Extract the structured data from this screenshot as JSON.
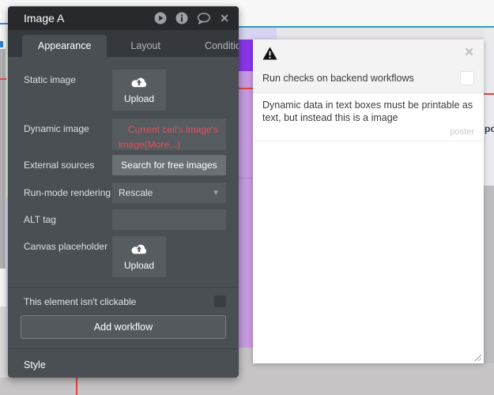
{
  "inspector": {
    "title": "Image A",
    "tabs": {
      "appearance": "Appearance",
      "layout": "Layout",
      "conditional": "Conditional"
    },
    "fields": {
      "static_image": {
        "label": "Static image",
        "button": "Upload"
      },
      "dynamic_image": {
        "label": "Dynamic image",
        "value": "Current cell's image's image(More...)"
      },
      "external_sources": {
        "label": "External sources",
        "button": "Search for free images"
      },
      "run_mode": {
        "label": "Run-mode rendering",
        "value": "Rescale"
      },
      "alt_tag": {
        "label": "ALT tag",
        "value": ""
      },
      "canvas_placeholder": {
        "label": "Canvas placeholder",
        "button": "Upload"
      }
    },
    "clickable": {
      "label": "This element isn't clickable",
      "checked": false
    },
    "add_workflow": "Add workflow",
    "style_section": "Style",
    "titlebar_icons": [
      "play-icon",
      "info-icon",
      "comment-icon",
      "close-icon"
    ]
  },
  "issues": {
    "run_checks_label": "Run checks on backend workflows",
    "run_checks_checked": false,
    "message": "Dynamic data in text boxes must be printable as text, but instead this is a image",
    "source_element": "poster",
    "icon": "warning-icon"
  },
  "canvas": {
    "clipped_text": "po"
  },
  "colors": {
    "panel_body": "#4a4f54",
    "titlebar": "#27292c",
    "control_bg": "#565b60",
    "error_text": "#e0515c",
    "accent_purple": "#8936e8",
    "orchid": "#c79ae0",
    "teal_guide": "#2f9db4",
    "red_guide": "#e0473c",
    "dialog_header": "#f4f3f4"
  }
}
